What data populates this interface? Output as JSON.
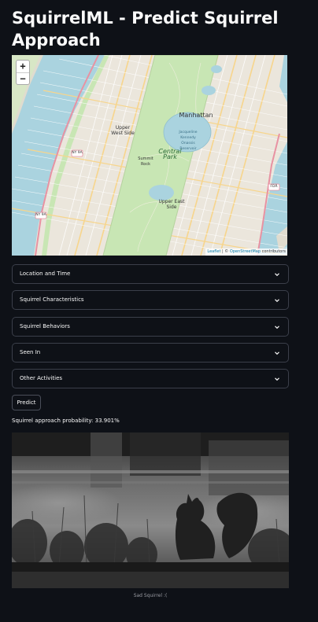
{
  "app": {
    "title": "SquirrelML - Predict Squirrel Approach"
  },
  "map": {
    "zoom_in": "+",
    "zoom_out": "−",
    "attribution_leaflet": "Leaflet",
    "attribution_sep": " | © ",
    "attribution_osm": "OpenStreetMap",
    "attribution_tail": " contributors",
    "labels": {
      "manhattan": "Manhattan",
      "upper_west_side": "Upper West Side",
      "upper_east_side": "Upper East Side",
      "central_park": "Central Park",
      "summit_rock": "Summit Rock",
      "reservoir": "Jacqueline Kennedy Onassis Reservoir",
      "ny9a_top": "NY 9A",
      "ny9a_bottom": "NY 9A",
      "fdr": "FDR"
    }
  },
  "expanders": [
    {
      "label": "Location and Time"
    },
    {
      "label": "Squirrel Characteristics"
    },
    {
      "label": "Squirrel Behaviors"
    },
    {
      "label": "Seen In"
    },
    {
      "label": "Other Activities"
    }
  ],
  "predict_button": "Predict",
  "result": {
    "text": "Squirrel approach probability: 33.901%"
  },
  "image": {
    "caption": "Sad Squirrel :("
  },
  "colors": {
    "background": "#0e1117",
    "text": "#fafafa",
    "border": "#3b3f4a",
    "water": "#aad3df",
    "park": "#c8e6b4"
  }
}
